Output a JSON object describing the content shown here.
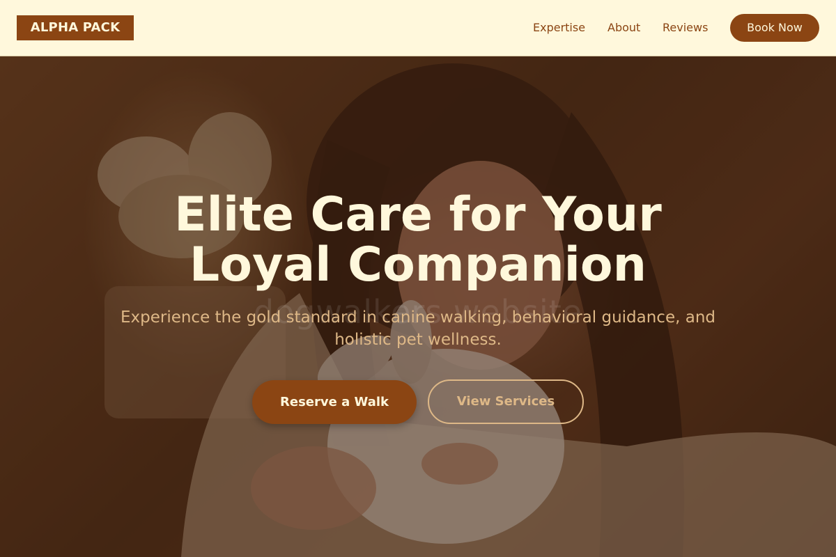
{
  "header": {
    "logo": "ALPHA PACK",
    "nav": [
      {
        "label": "Expertise"
      },
      {
        "label": "About"
      },
      {
        "label": "Reviews"
      }
    ],
    "cta_label": "Book Now"
  },
  "hero": {
    "title_line1": "Elite Care for Your",
    "title_line2": "Loyal Companion",
    "watermark": "dogwalkers website",
    "subtitle": "Experience the gold standard in canine walking, behavioral guidance, and holistic pet wellness.",
    "primary_button": "Reserve a Walk",
    "secondary_button": "View Services"
  },
  "colors": {
    "brand": "#8b4513",
    "cream": "#fff8dc",
    "accent": "#deb887"
  }
}
